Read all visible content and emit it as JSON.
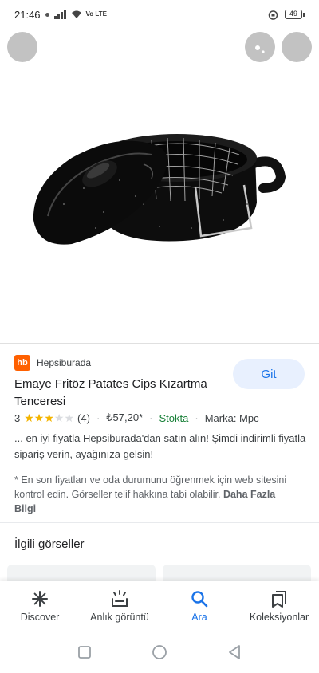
{
  "status_bar": {
    "time": "21:46",
    "network": "Vo LTE",
    "battery": "49"
  },
  "product": {
    "source": "Hepsiburada",
    "source_logo_text": "hb",
    "visit_label": "Git",
    "title": "Emaye Fritöz Patates Cips Kızartma Tenceresi",
    "rating": "3",
    "rating_value": 3,
    "review_count": "(4)",
    "price": "₺57,20*",
    "stock": "Stokta",
    "brand": "Marka: Mpc",
    "description": "... en iyi fiyatla Hepsiburada'dan satın alın! Şimdi indirimli fiyatla sipariş verin, ayağınıza gelsin!",
    "note": "* En son fiyatları ve oda durumunu öğrenmek için web sitesini kontrol edin. Görseller telif hakkına tabi olabilir.",
    "more_info": "Daha Fazla Bilgi"
  },
  "related": {
    "title": "İlgili görseller"
  },
  "bottom_nav": {
    "items": [
      {
        "label": "Discover",
        "icon": "asterisk-icon"
      },
      {
        "label": "Anlık görüntü",
        "icon": "snapshot-icon"
      },
      {
        "label": "Ara",
        "icon": "search-icon"
      },
      {
        "label": "Koleksiyonlar",
        "icon": "collections-icon"
      }
    ]
  },
  "colors": {
    "accent": "#1a73e8",
    "brand_logo": "#ff6000",
    "stock_green": "#188038",
    "star": "#f4b400"
  }
}
